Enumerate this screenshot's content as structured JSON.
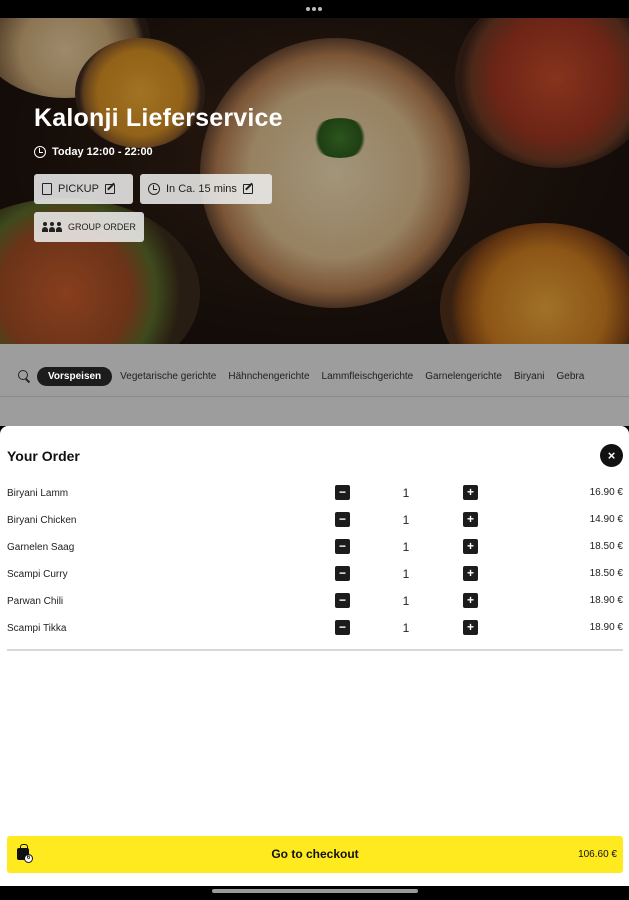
{
  "restaurant": {
    "name": "Kalonji Lieferservice",
    "hours": "Today 12:00 - 22:00",
    "pickup_label": "PICKUP",
    "time_label": "In Ca. 15 mins",
    "group_order_label": "GROUP ORDER"
  },
  "categories": [
    {
      "label": "Vorspeisen",
      "active": true
    },
    {
      "label": "Vegetarische gerichte"
    },
    {
      "label": "Hähnchengerichte"
    },
    {
      "label": "Lammfleischgerichte"
    },
    {
      "label": "Garnelengerichte"
    },
    {
      "label": "Biryani"
    },
    {
      "label": "Gebra"
    }
  ],
  "order": {
    "title": "Your Order",
    "close_symbol": "×",
    "items": [
      {
        "name": "Biryani Lamm",
        "qty": "1",
        "price": "16.90 €"
      },
      {
        "name": "Biryani Chicken",
        "qty": "1",
        "price": "14.90 €"
      },
      {
        "name": "Garnelen Saag",
        "qty": "1",
        "price": "18.50 €"
      },
      {
        "name": "Scampi Curry",
        "qty": "1",
        "price": "18.50 €"
      },
      {
        "name": "Parwan Chili",
        "qty": "1",
        "price": "18.90 €"
      },
      {
        "name": "Scampi Tikka",
        "qty": "1",
        "price": "18.90 €"
      }
    ],
    "minus_symbol": "−",
    "plus_symbol": "+"
  },
  "checkout": {
    "label": "Go to checkout",
    "total": "106.60 €",
    "cart_count": "6",
    "accent_color": "#ffe91f"
  }
}
